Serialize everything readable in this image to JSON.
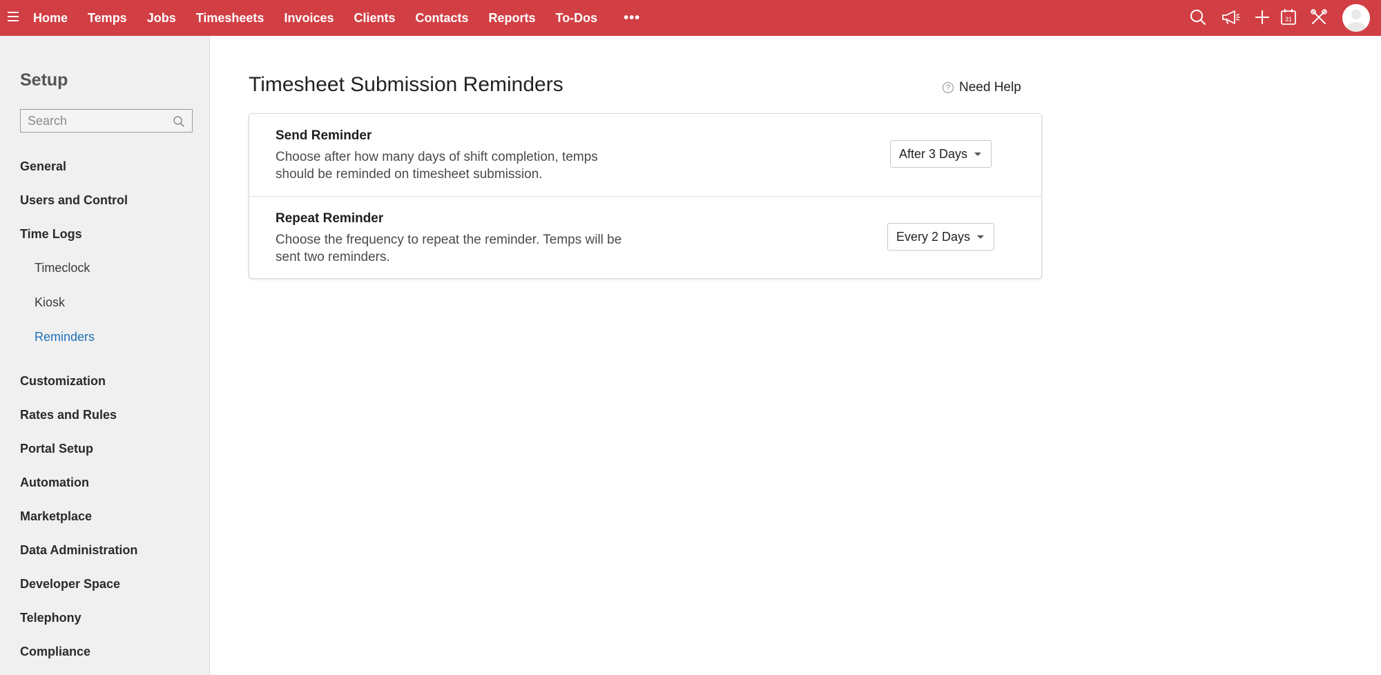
{
  "topbar": {
    "nav": [
      "Home",
      "Temps",
      "Jobs",
      "Timesheets",
      "Invoices",
      "Clients",
      "Contacts",
      "Reports",
      "To-Dos"
    ],
    "more": "•••",
    "icons": [
      "search-icon",
      "megaphone-icon",
      "plus-icon",
      "calendar-icon",
      "tools-icon",
      "avatar"
    ],
    "calendar_day": "31",
    "bar_color": "#d13f44"
  },
  "sidebar": {
    "title": "Setup",
    "search_placeholder": "Search",
    "items": {
      "general": "General",
      "users": "Users and Control",
      "timelogs": "Time Logs",
      "timeclock": "Timeclock",
      "kiosk": "Kiosk",
      "reminders": "Reminders",
      "customization": "Customization",
      "rates": "Rates and Rules",
      "portal": "Portal Setup",
      "automation": "Automation",
      "marketplace": "Marketplace",
      "data_admin": "Data Administration",
      "developer": "Developer Space",
      "telephony": "Telephony",
      "compliance": "Compliance"
    },
    "active_color": "#1f6fb8"
  },
  "main": {
    "title": "Timesheet Submission Reminders",
    "help_label": "Need Help",
    "help_icon": "?",
    "send": {
      "title": "Send Reminder",
      "desc": "Choose after how many days of shift completion, temps should be reminded on timesheet submission.",
      "value": "After 3 Days"
    },
    "repeat": {
      "title": "Repeat Reminder",
      "desc": "Choose the frequency to repeat the reminder. Temps will be sent two reminders.",
      "value": "Every 2 Days"
    }
  }
}
